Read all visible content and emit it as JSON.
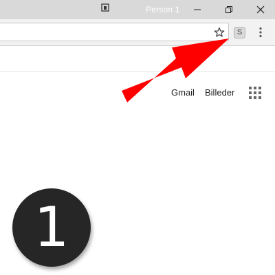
{
  "window": {
    "profile_name": "Person 1",
    "controls": [
      "minimize-icon",
      "restore-icon",
      "close-icon"
    ]
  },
  "toolbar": {
    "address_value": "",
    "bookmark_icon": "star-icon",
    "extension": {
      "icon": "extension-icon",
      "letter": "S"
    },
    "menu_icon": "more-vert-icon"
  },
  "google": {
    "gmail_label": "Gmail",
    "images_label": "Billeder",
    "apps_icon": "apps-grid-icon"
  },
  "annotation": {
    "arrow_color": "#ff0000",
    "step_number": "1",
    "badge_color": "#262626"
  }
}
